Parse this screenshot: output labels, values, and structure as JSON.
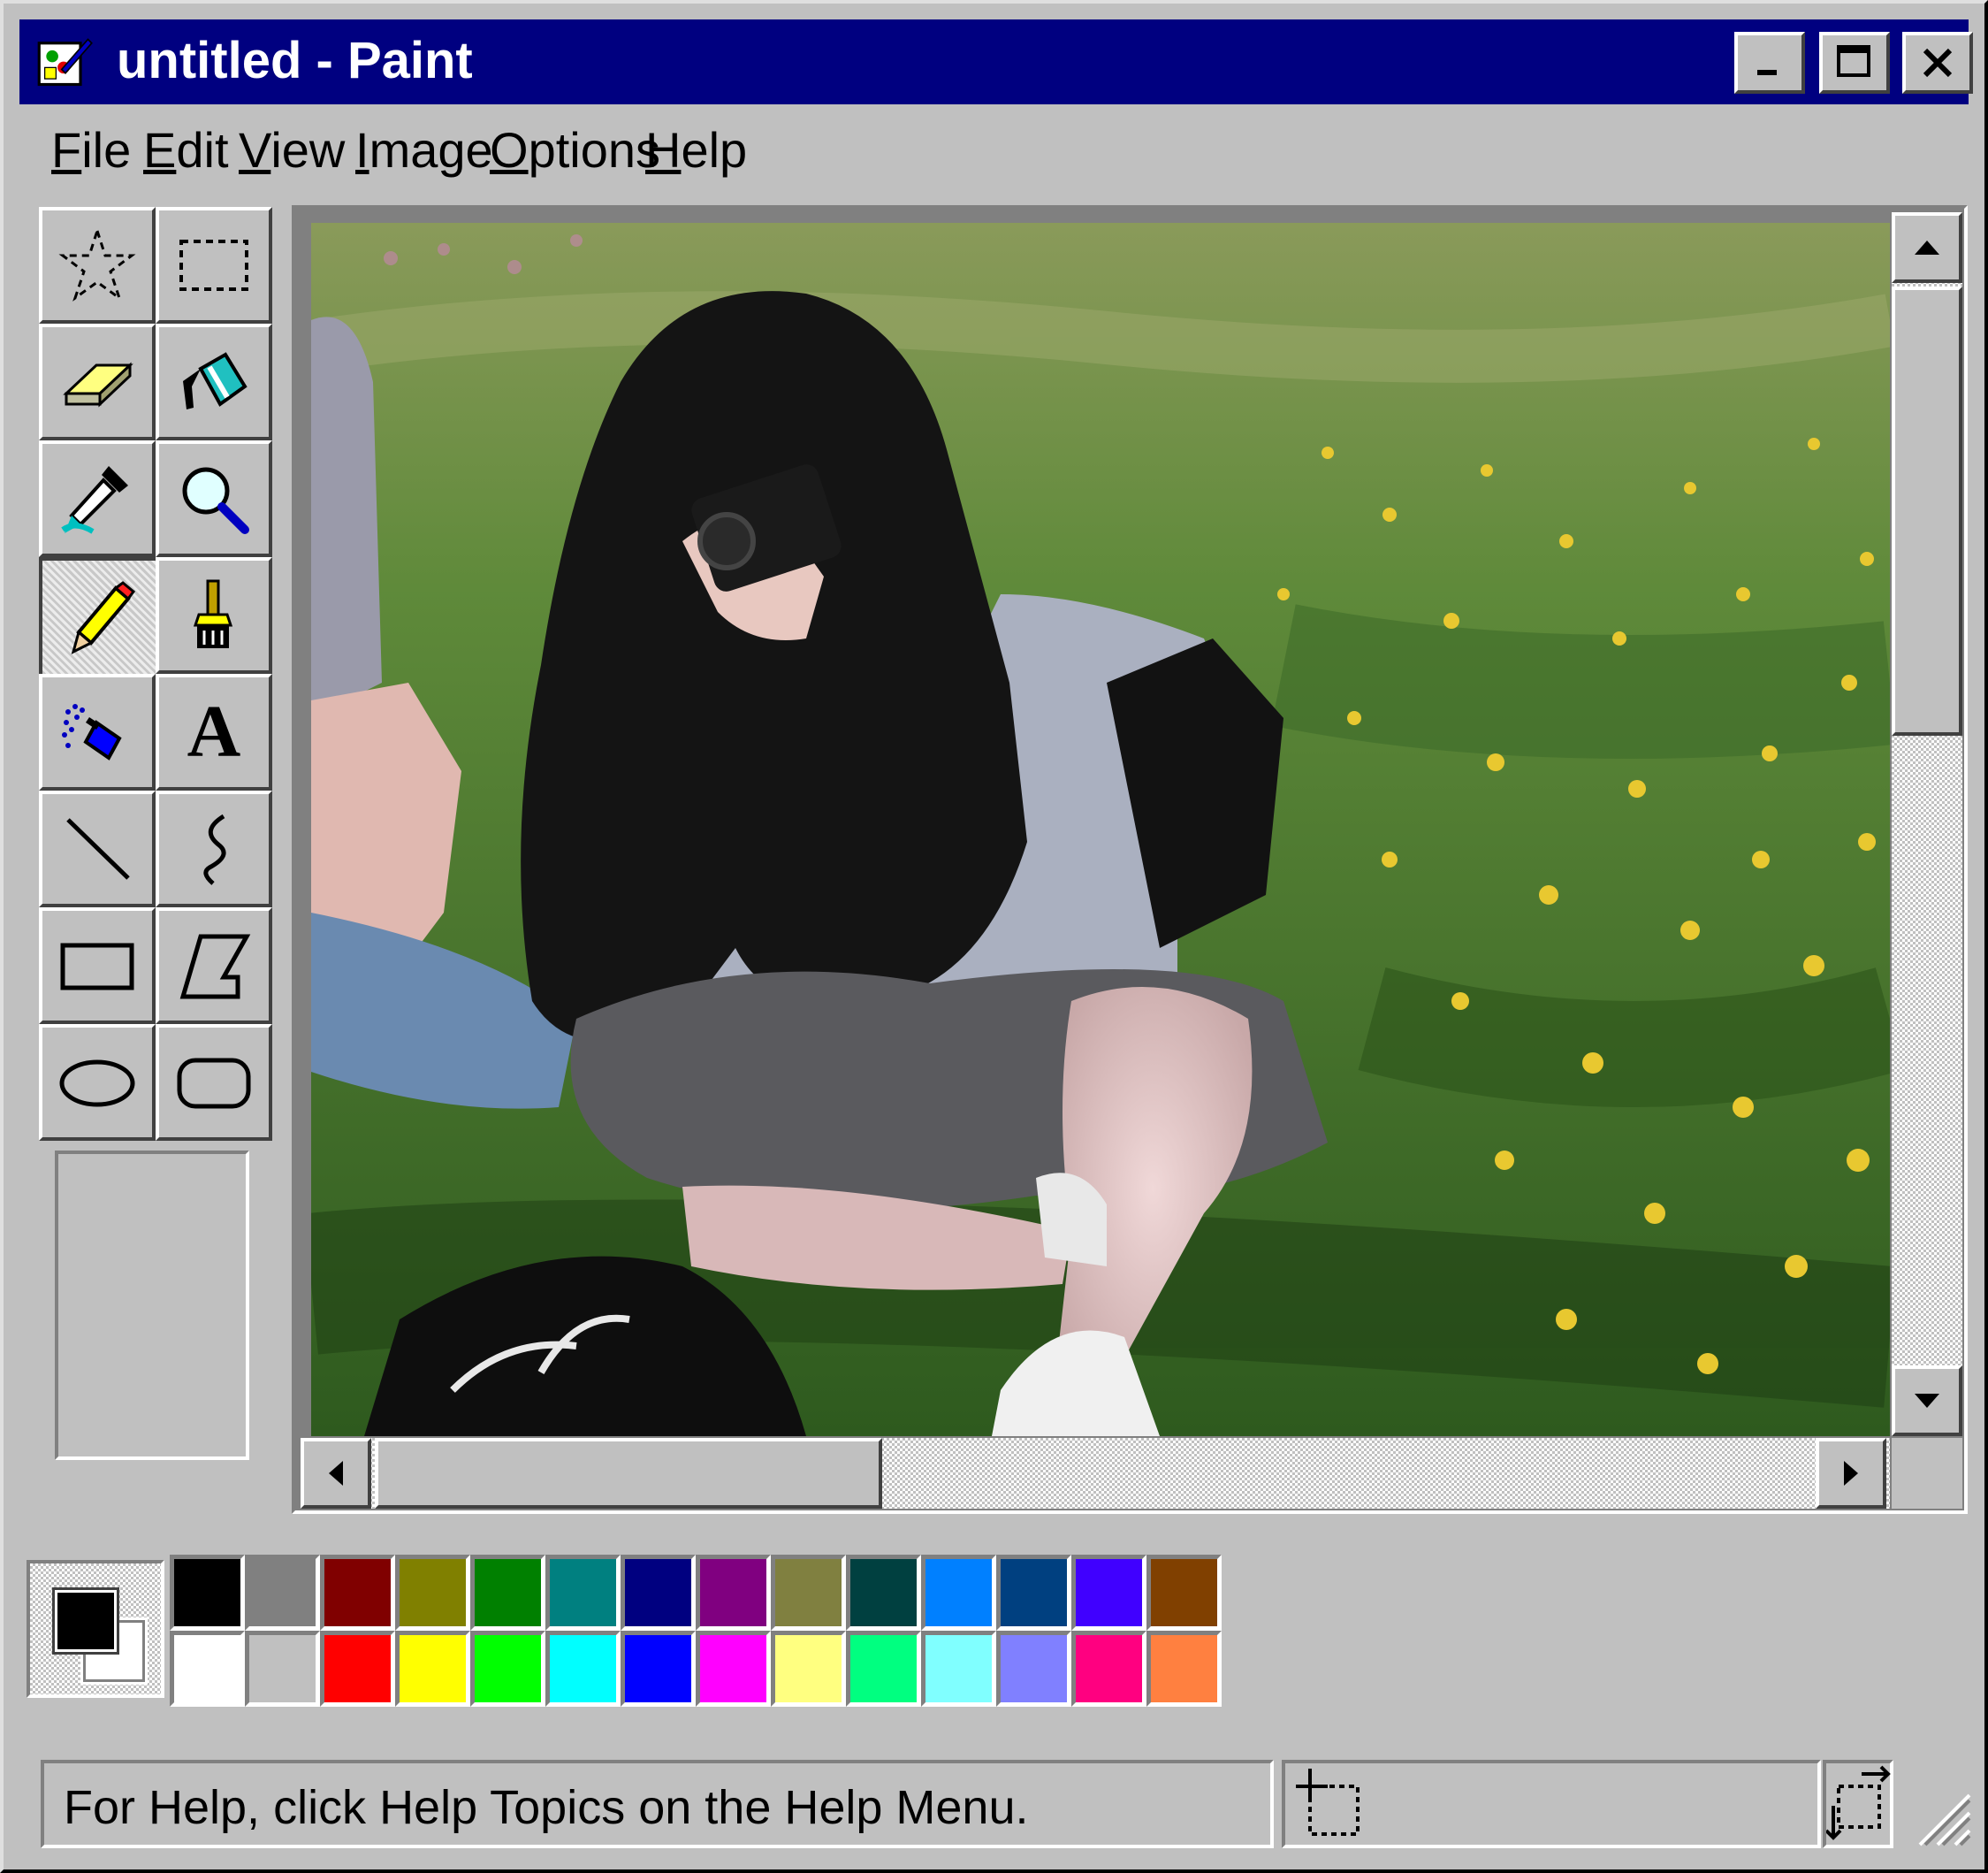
{
  "window": {
    "title": "untitled - Paint"
  },
  "menu": {
    "items": [
      "File",
      "Edit",
      "View",
      "Image",
      "Options",
      "Help"
    ]
  },
  "toolbox": {
    "tools": [
      "free-form-select",
      "select",
      "eraser",
      "fill-with-color",
      "pick-color",
      "magnifier",
      "pencil",
      "brush",
      "airbrush",
      "text",
      "line",
      "curve",
      "rectangle",
      "polygon",
      "ellipse",
      "rounded-rectangle"
    ],
    "active_tool": "pencil",
    "text_tool_glyph": "A"
  },
  "palette": {
    "foreground": "#000000",
    "background": "#ffffff",
    "row1": [
      "#000000",
      "#808080",
      "#800000",
      "#808000",
      "#008000",
      "#008080",
      "#000080",
      "#800080",
      "#808040",
      "#004040",
      "#0080ff",
      "#004080",
      "#4000ff",
      "#804000"
    ],
    "row2": [
      "#ffffff",
      "#c0c0c0",
      "#ff0000",
      "#ffff00",
      "#00ff00",
      "#00ffff",
      "#0000ff",
      "#ff00ff",
      "#ffff80",
      "#00ff80",
      "#80ffff",
      "#8080ff",
      "#ff0080",
      "#ff8040"
    ]
  },
  "status": {
    "help_text": "For Help, click Help Topics on the Help Menu."
  },
  "scroll": {
    "vertical_fraction": 0.28,
    "horizontal_fraction": 0.3
  }
}
